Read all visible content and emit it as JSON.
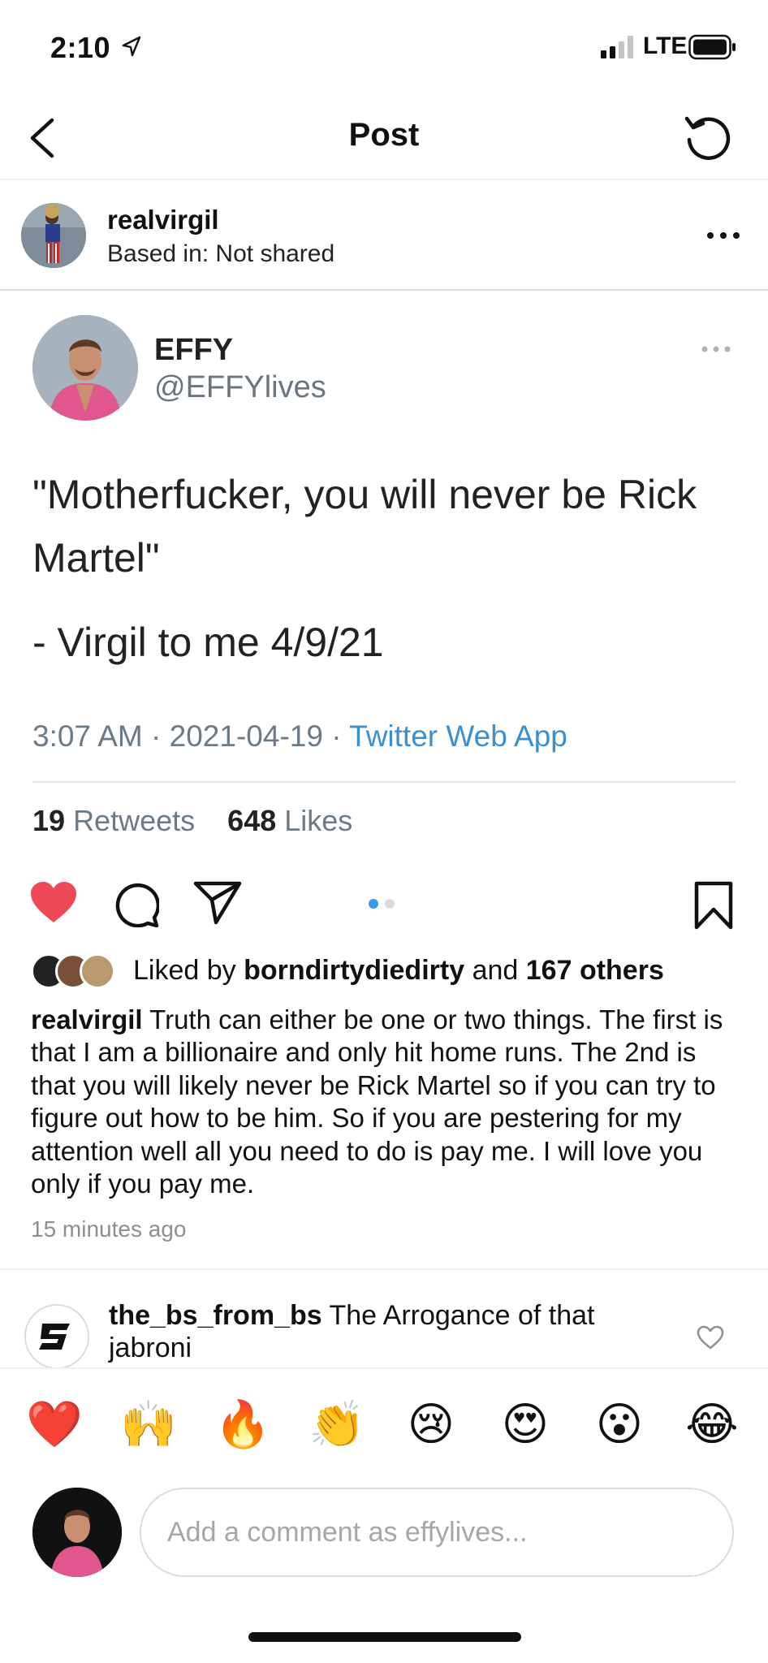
{
  "status_bar": {
    "time": "2:10",
    "network": "LTE",
    "icons": [
      "location-arrow-icon",
      "signal-icon",
      "battery-icon"
    ]
  },
  "nav": {
    "title": "Post",
    "back_icon": "chevron-left-icon",
    "refresh_icon": "refresh-icon"
  },
  "post_header": {
    "username": "realvirgil",
    "location": "Based in: Not shared",
    "more_icon": "more-horizontal-icon"
  },
  "tweet": {
    "name": "EFFY",
    "handle": "@EFFYlives",
    "text_line1": "\"Motherfucker, you will never be Rick Martel\"",
    "text_line2": "- Virgil to me 4/9/21",
    "time": "3:07 AM",
    "date": "2021-04-19",
    "separator": "·",
    "source": "Twitter Web App",
    "retweets_count": "19",
    "retweets_label": "Retweets",
    "likes_count": "648",
    "likes_label": "Likes"
  },
  "actions": {
    "like_icon": "heart-filled-icon",
    "comment_icon": "comment-icon",
    "share_icon": "send-icon",
    "save_icon": "bookmark-icon",
    "carousel_pages": 2,
    "carousel_active": 1,
    "colors": {
      "like": "#ed4956",
      "active_dot": "#3897f0",
      "inactive_dot": "#dbdbdb"
    }
  },
  "likes": {
    "prefix": "Liked by",
    "user": "borndirtydiedirty",
    "conjunction": "and",
    "others": "167 others"
  },
  "caption": {
    "username": "realvirgil",
    "text": "Truth can either be one or two things. The first is that I am a billionaire and only hit home runs. The 2nd is that you will likely never be Rick Martel so if you can try to figure out how to be him. So if you are pestering for my attention well all you need to do is pay me. I will love you only if you pay me.",
    "time_ago": "15 minutes ago"
  },
  "comment": {
    "username": "the_bs_from_bs",
    "text": "The Arrogance of that jabroni",
    "heart_icon": "heart-outline-icon"
  },
  "emoji_bar": [
    "❤️",
    "🙌",
    "🔥",
    "👏",
    "😢",
    "😍",
    "😮",
    "😂"
  ],
  "comment_input": {
    "placeholder": "Add a comment as effylives..."
  }
}
